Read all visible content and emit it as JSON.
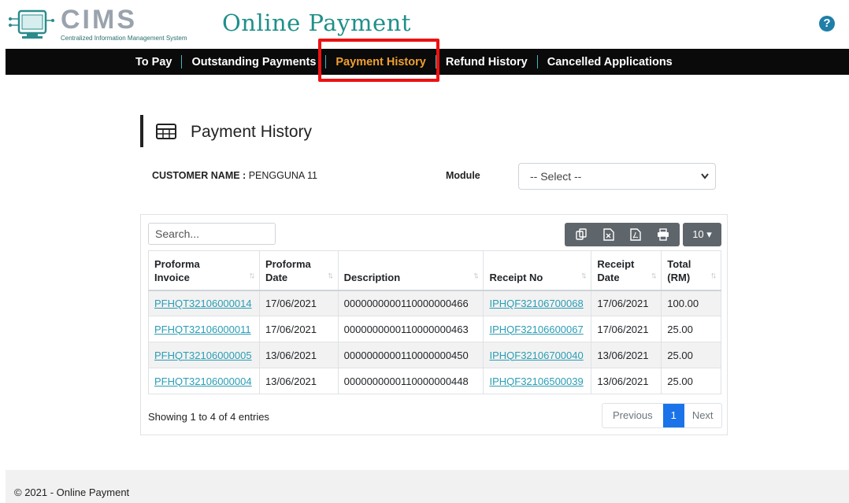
{
  "header": {
    "logo_word": "CIMS",
    "logo_subtitle": "Centralized Information Management System",
    "app_title": "Online Payment",
    "help_glyph": "?"
  },
  "nav": {
    "items": [
      "To Pay",
      "Outstanding Payments",
      "Payment History",
      "Refund History",
      "Cancelled Applications"
    ],
    "active": "Payment History"
  },
  "page": {
    "title": "Payment History",
    "customer_label": "CUSTOMER NAME :",
    "customer_name": "PENGGUNA 11",
    "module_label": "Module",
    "module_selected": "-- Select --"
  },
  "table_controls": {
    "search_placeholder": "Search...",
    "page_length": "10"
  },
  "table": {
    "headers": {
      "invoice_line1": "Proforma",
      "invoice_line2": "Invoice",
      "date_line1": "Proforma",
      "date_line2": "Date",
      "description": "Description",
      "receipt_no": "Receipt No",
      "receipt_date_line1": "Receipt",
      "receipt_date_line2": "Date",
      "total_line1": "Total",
      "total_line2": "(RM)"
    },
    "rows": [
      {
        "invoice": "PFHQT32106000014",
        "date": "17/06/2021",
        "description": "0000000000110000000466",
        "receipt_no": "IPHQF32106700068",
        "receipt_date": "17/06/2021",
        "total": "100.00"
      },
      {
        "invoice": "PFHQT32106000011",
        "date": "17/06/2021",
        "description": "0000000000110000000463",
        "receipt_no": "IPHQF32106600067",
        "receipt_date": "17/06/2021",
        "total": "25.00"
      },
      {
        "invoice": "PFHQT32106000005",
        "date": "13/06/2021",
        "description": "0000000000110000000450",
        "receipt_no": "IPHQF32106700040",
        "receipt_date": "13/06/2021",
        "total": "25.00"
      },
      {
        "invoice": "PFHQT32106000004",
        "date": "13/06/2021",
        "description": "0000000000110000000448",
        "receipt_no": "IPHQF32106500039",
        "receipt_date": "13/06/2021",
        "total": "25.00"
      }
    ]
  },
  "pagination": {
    "info": "Showing 1 to 4 of 4 entries",
    "previous": "Previous",
    "current": "1",
    "next": "Next"
  },
  "footer": {
    "text": "© 2021 - Online Payment"
  },
  "colors": {
    "brand_teal": "#1f8f8a",
    "nav_active": "#f0a030",
    "highlight_red": "#e11111",
    "link": "#2a9db5",
    "page_active": "#1a73e8"
  }
}
